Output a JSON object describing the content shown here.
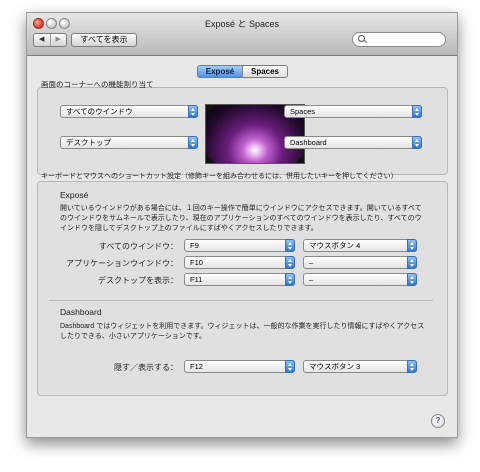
{
  "window": {
    "title": "Exposé と Spaces",
    "show_all_label": "すべてを表示",
    "nav_back": "◀",
    "nav_forward": "▶",
    "search_value": ""
  },
  "tabs": [
    {
      "label": "Exposé",
      "selected": true
    },
    {
      "label": "Spaces",
      "selected": false
    }
  ],
  "corners": {
    "label": "画面のコーナーへの機能割り当て",
    "top_left": "すべてのウインドウ",
    "bottom_left": "デスクトップ",
    "top_right": "Spaces",
    "bottom_right": "Dashboard"
  },
  "shortcuts_label": "キーボードとマウスへのショートカット設定（修飾キーを組み合わせるには、併用したいキーを押してください）",
  "expose": {
    "heading": "Exposé",
    "description": "開いているウインドウがある場合には、１回のキー操作で簡単にウインドウにアクセスできます。開いているすべてのウインドウをサムネールで表示したり、現在のアプリケーションのすべてのウインドウを表示したり、すべてのウインドウを隠してデスクトップ上のファイルにすばやくアクセスしたりできます。",
    "rows": [
      {
        "label": "すべてのウインドウ：",
        "key": "F9",
        "mouse": "マウスボタン 4"
      },
      {
        "label": "アプリケーションウインドウ：",
        "key": "F10",
        "mouse": "–"
      },
      {
        "label": "デスクトップを表示：",
        "key": "F11",
        "mouse": "–"
      }
    ]
  },
  "dashboard": {
    "heading": "Dashboard",
    "description": "Dashboard ではウィジェットを利用できます。ウィジェットは、一般的な作業を実行したり情報にすばやくアクセスしたりできる、小さいアプリケーションです。",
    "row": {
      "label": "隠す／表示する：",
      "key": "F12",
      "mouse": "マウスボタン 3"
    }
  },
  "help_label": "?"
}
